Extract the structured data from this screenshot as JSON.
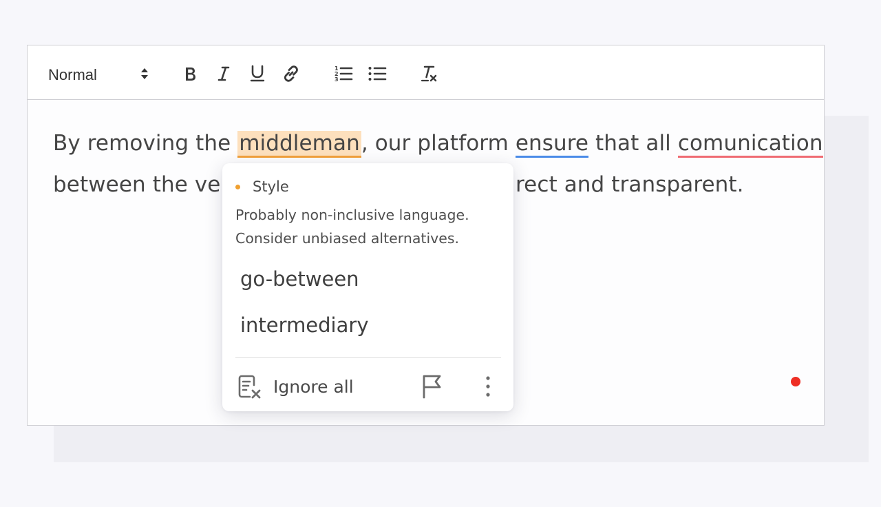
{
  "toolbar": {
    "format_value": "Normal",
    "buttons": [
      "bold-icon",
      "italic-icon",
      "underline-icon",
      "link-icon",
      "numbered-list-icon",
      "bulleted-list-icon",
      "clear-formatting-icon"
    ]
  },
  "content": {
    "line1": {
      "before": "By removing the ",
      "flag_style": "middleman",
      "middle1": ", our platform ",
      "flag_grammar": "ensure",
      "middle2": " that all ",
      "flag_spelling": "comunication"
    },
    "line2": {
      "visible_start": "between the ven",
      "visible_end": "rect and transparent."
    }
  },
  "popover": {
    "category": "Style",
    "message_line1": "Probably non-inclusive language.",
    "message_line2": "Consider unbiased alternatives.",
    "suggestions": [
      "go-between",
      "intermediary"
    ],
    "ignore_label": "Ignore all"
  },
  "colors": {
    "style_highlight": "#fde0bd",
    "style_underline": "#f2a13a",
    "grammar_underline": "#4a8be8",
    "spelling_underline": "#ef6b73",
    "status_dot": "#ee2e24"
  }
}
